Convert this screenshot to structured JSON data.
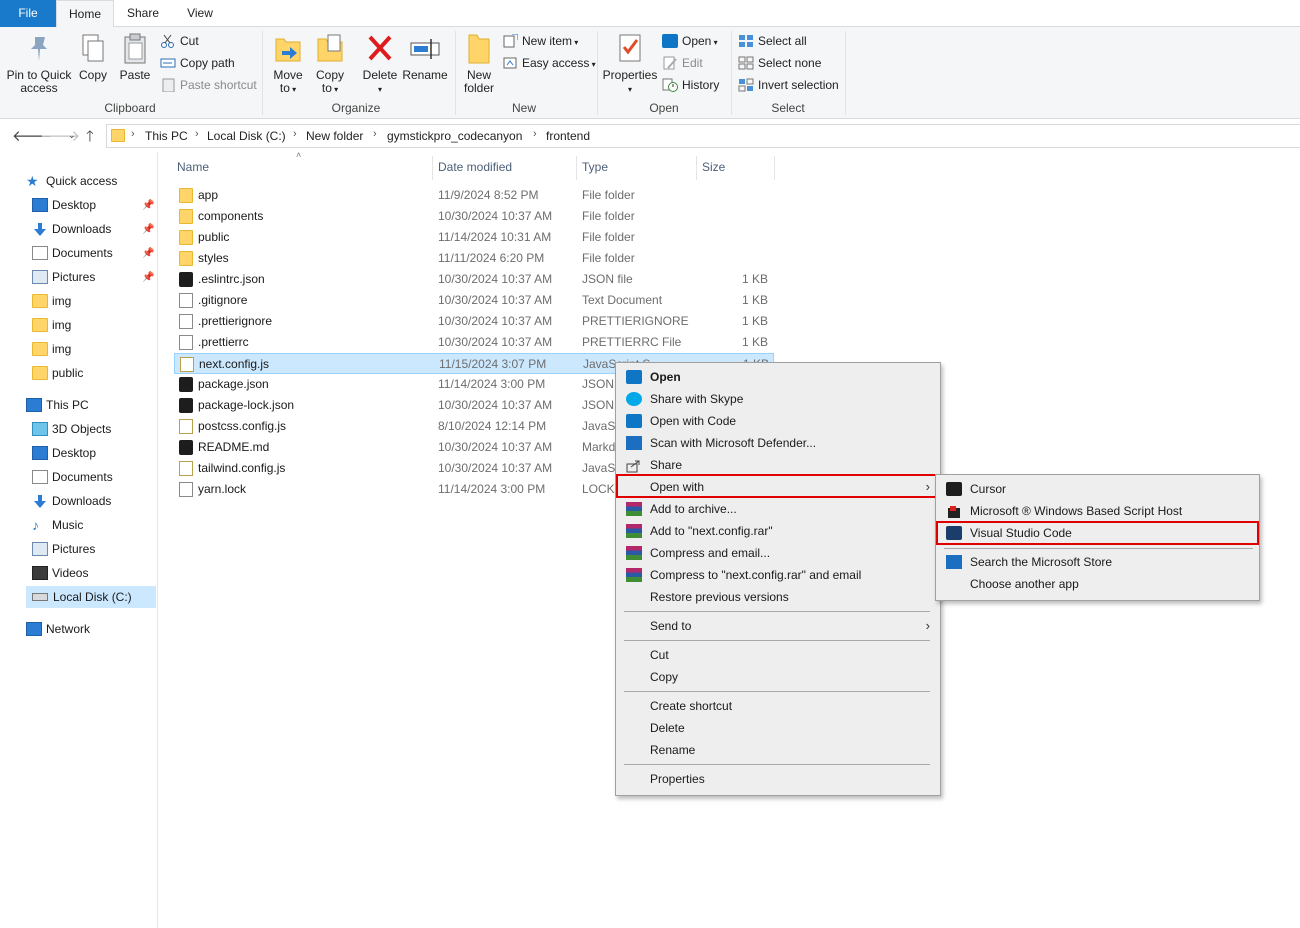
{
  "ribbon": {
    "tabs": {
      "file": "File",
      "home": "Home",
      "share": "Share",
      "view": "View"
    },
    "clipboard": {
      "pin": "Pin to Quick access",
      "pin_l1": "Pin to Quick",
      "pin_l2": "access",
      "copy": "Copy",
      "paste": "Paste",
      "cut": "Cut",
      "copy_path": "Copy path",
      "paste_shortcut": "Paste shortcut",
      "label": "Clipboard"
    },
    "organize": {
      "move_l1": "Move",
      "move_l2": "to",
      "copy_l1": "Copy",
      "copy_l2": "to",
      "delete": "Delete",
      "rename": "Rename",
      "label": "Organize"
    },
    "new": {
      "folder_l1": "New",
      "folder_l2": "folder",
      "new_item": "New item",
      "easy_access": "Easy access",
      "label": "New"
    },
    "open": {
      "properties": "Properties",
      "open": "Open",
      "edit": "Edit",
      "history": "History",
      "label": "Open"
    },
    "select": {
      "select_all": "Select all",
      "select_none": "Select none",
      "invert": "Invert selection",
      "label": "Select"
    }
  },
  "address": {
    "crumbs": [
      "This PC",
      "Local Disk (C:)",
      "New folder",
      "gymstickpro_codecanyon",
      "frontend"
    ]
  },
  "nav": {
    "quick_access": "Quick access",
    "quick_items": [
      "Desktop",
      "Downloads",
      "Documents",
      "Pictures",
      "img",
      "img",
      "img",
      "public"
    ],
    "this_pc": "This PC",
    "pc_items": [
      "3D Objects",
      "Desktop",
      "Documents",
      "Downloads",
      "Music",
      "Pictures",
      "Videos",
      "Local Disk (C:)"
    ],
    "network": "Network"
  },
  "columns": {
    "name": "Name",
    "date": "Date modified",
    "type": "Type",
    "size": "Size"
  },
  "files": [
    {
      "name": "app",
      "date": "11/9/2024 8:52 PM",
      "type": "File folder",
      "size": "",
      "icon": "folder"
    },
    {
      "name": "components",
      "date": "10/30/2024 10:37 AM",
      "type": "File folder",
      "size": "",
      "icon": "folder"
    },
    {
      "name": "public",
      "date": "11/14/2024 10:31 AM",
      "type": "File folder",
      "size": "",
      "icon": "folder"
    },
    {
      "name": "styles",
      "date": "11/11/2024 6:20 PM",
      "type": "File folder",
      "size": "",
      "icon": "folder"
    },
    {
      "name": ".eslintrc.json",
      "date": "10/30/2024 10:37 AM",
      "type": "JSON file",
      "size": "1 KB",
      "icon": "json"
    },
    {
      "name": ".gitignore",
      "date": "10/30/2024 10:37 AM",
      "type": "Text Document",
      "size": "1 KB",
      "icon": "doc"
    },
    {
      "name": ".prettierignore",
      "date": "10/30/2024 10:37 AM",
      "type": "PRETTIERIGNORE ...",
      "size": "1 KB",
      "icon": "doc"
    },
    {
      "name": ".prettierrc",
      "date": "10/30/2024 10:37 AM",
      "type": "PRETTIERRC File",
      "size": "1 KB",
      "icon": "doc"
    },
    {
      "name": "next.config.js",
      "date": "11/15/2024 3:07 PM",
      "type": "JavaScript S",
      "size": "1 KB",
      "icon": "js"
    },
    {
      "name": "package.json",
      "date": "11/14/2024 3:00 PM",
      "type": "JSON f",
      "size": "",
      "icon": "json"
    },
    {
      "name": "package-lock.json",
      "date": "10/30/2024 10:37 AM",
      "type": "JSON f",
      "size": "",
      "icon": "json"
    },
    {
      "name": "postcss.config.js",
      "date": "8/10/2024 12:14 PM",
      "type": "JavaSc",
      "size": "",
      "icon": "js"
    },
    {
      "name": "README.md",
      "date": "10/30/2024 10:37 AM",
      "type": "Markd",
      "size": "",
      "icon": "json"
    },
    {
      "name": "tailwind.config.js",
      "date": "10/30/2024 10:37 AM",
      "type": "JavaSc",
      "size": "",
      "icon": "js"
    },
    {
      "name": "yarn.lock",
      "date": "11/14/2024 3:00 PM",
      "type": "LOCK",
      "size": "",
      "icon": "doc"
    }
  ],
  "context_menu": {
    "open": "Open",
    "share_skype": "Share with Skype",
    "open_code": "Open with Code",
    "scan_defender": "Scan with Microsoft Defender...",
    "share": "Share",
    "open_with": "Open with",
    "add_archive": "Add to archive...",
    "add_rar": "Add to \"next.config.rar\"",
    "compress_email": "Compress and email...",
    "compress_rar_email": "Compress to \"next.config.rar\" and email",
    "restore": "Restore previous versions",
    "send_to": "Send to",
    "cut": "Cut",
    "copy": "Copy",
    "create_shortcut": "Create shortcut",
    "delete": "Delete",
    "rename": "Rename",
    "properties": "Properties"
  },
  "submenu": {
    "cursor": "Cursor",
    "wsh": "Microsoft ® Windows Based Script Host",
    "vscode": "Visual Studio Code",
    "store": "Search the Microsoft Store",
    "another": "Choose another app"
  }
}
